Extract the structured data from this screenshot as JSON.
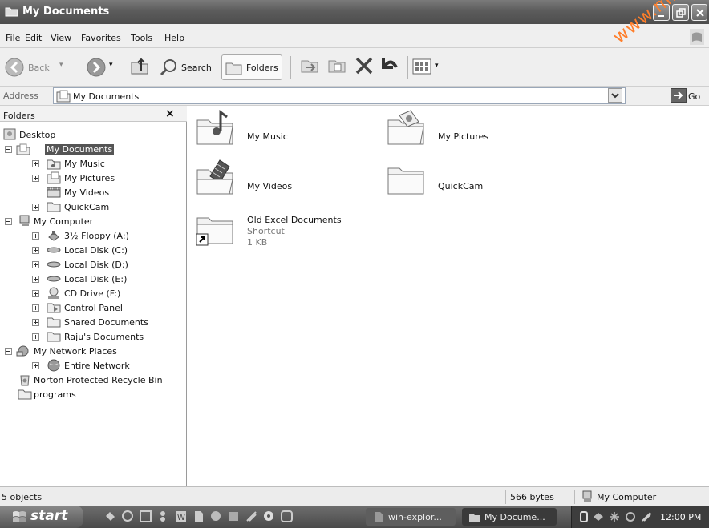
{
  "window": {
    "title": "My Documents"
  },
  "menu": [
    "File",
    "Edit",
    "View",
    "Favorites",
    "Tools",
    "Help"
  ],
  "toolbar": {
    "back": "Back",
    "search": "Search",
    "folders": "Folders"
  },
  "address": {
    "label": "Address",
    "value": "My Documents",
    "go": "Go"
  },
  "folders_pane": {
    "title": "Folders",
    "close": "×",
    "items": [
      {
        "label": "Desktop"
      },
      {
        "label": "My Documents"
      },
      {
        "label": "My Music"
      },
      {
        "label": "My Pictures"
      },
      {
        "label": "My Videos"
      },
      {
        "label": "QuickCam"
      },
      {
        "label": "My Computer"
      },
      {
        "label": "3½ Floppy (A:)"
      },
      {
        "label": "Local Disk (C:)"
      },
      {
        "label": "Local Disk (D:)"
      },
      {
        "label": "Local Disk (E:)"
      },
      {
        "label": "CD Drive (F:)"
      },
      {
        "label": "Control Panel"
      },
      {
        "label": "Shared Documents"
      },
      {
        "label": "Raju's Documents"
      },
      {
        "label": "My Network Places"
      },
      {
        "label": "Entire Network"
      },
      {
        "label": "Norton Protected Recycle Bin"
      },
      {
        "label": "programs"
      }
    ]
  },
  "content": {
    "items": [
      {
        "name": "My Music"
      },
      {
        "name": "My Pictures"
      },
      {
        "name": "My Videos"
      },
      {
        "name": "QuickCam"
      },
      {
        "name": "Old Excel Documents",
        "type": "Shortcut",
        "size": "1 KB"
      }
    ]
  },
  "status": {
    "count": "5 objects",
    "size": "566 bytes",
    "location": "My Computer"
  },
  "taskbar": {
    "start": "start",
    "tasks": [
      "win-explor...",
      "My Docume..."
    ],
    "clock": "12:00 PM"
  },
  "watermark": "www.mb",
  "colors": {
    "selected": "#555555",
    "titlebar": "#5c5c5c",
    "watermark": "#ff7e2a"
  }
}
